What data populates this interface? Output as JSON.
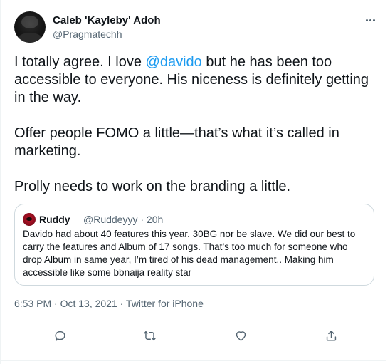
{
  "author": {
    "display_name": "Caleb 'Kayleby' Adoh",
    "handle": "@Pragmatechh"
  },
  "tweet": {
    "line1_before": "I totally agree. I love ",
    "mention": "@davido",
    "line1_after": " but he has been too accessible to everyone. His niceness is definitely getting in the way.",
    "paragraph2": "Offer people FOMO a little—that’s what it’s called in marketing.",
    "paragraph3": "Prolly needs to work on the branding a little."
  },
  "quoted": {
    "display_name": "Ruddy",
    "handle_time": "@Ruddeyyy · 20h",
    "text": "Davido had about 40 features this year. 30BG nor be slave. We did our best to carry the features and Album of 17 songs. That’s too much for someone who drop Album in same year, I’m tired of his dead management.. Making him accessible like some bbnaija reality star"
  },
  "meta": {
    "timestamp": "6:53 PM · Oct 13, 2021 · Twitter for iPhone"
  },
  "actions": [
    "reply-icon",
    "retweet-icon",
    "like-icon",
    "share-icon"
  ],
  "colors": {
    "link": "#1d9bf0",
    "secondary": "#536471",
    "border": "#cfd9de"
  }
}
